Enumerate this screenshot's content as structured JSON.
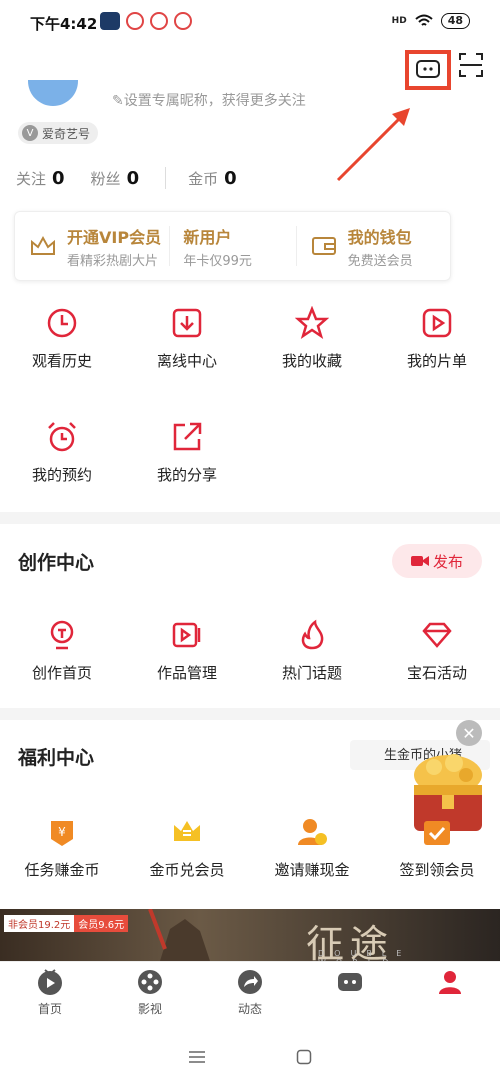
{
  "status_bar": {
    "time": "下午4:42",
    "battery": "48",
    "signal_label": "HD"
  },
  "header": {
    "nickname_hint": "设置专属昵称，获得更多关注",
    "brand_badge": "爱奇艺号",
    "brand_badge_icon": "V"
  },
  "stats": [
    {
      "label": "关注",
      "value": "0"
    },
    {
      "label": "粉丝",
      "value": "0"
    },
    {
      "label": "金币",
      "value": "0"
    }
  ],
  "vip_card": [
    {
      "title": "开通VIP会员",
      "subtitle": "看精彩热剧大片",
      "icon": "crown-icon"
    },
    {
      "title": "新用户",
      "subtitle": "年卡仅99元"
    },
    {
      "title": "我的钱包",
      "subtitle": "免费送会员",
      "icon": "wallet-icon"
    }
  ],
  "my_grid": [
    {
      "label": "观看历史",
      "icon": "clock-icon"
    },
    {
      "label": "离线中心",
      "icon": "download-icon"
    },
    {
      "label": "我的收藏",
      "icon": "star-icon"
    },
    {
      "label": "我的片单",
      "icon": "play-list-icon"
    },
    {
      "label": "我的预约",
      "icon": "alarm-icon"
    },
    {
      "label": "我的分享",
      "icon": "share-icon"
    }
  ],
  "creation": {
    "title": "创作中心",
    "publish_label": "发布",
    "items": [
      {
        "label": "创作首页",
        "icon": "creator-home-icon"
      },
      {
        "label": "作品管理",
        "icon": "video-manage-icon"
      },
      {
        "label": "热门话题",
        "icon": "fire-icon"
      },
      {
        "label": "宝石活动",
        "icon": "gem-icon"
      }
    ]
  },
  "welfare": {
    "title": "福利中心",
    "gold_tip": "生金币的小猪",
    "items": [
      {
        "label": "任务赚金币",
        "icon": "task-coin-icon"
      },
      {
        "label": "金币兑会员",
        "icon": "crown-coin-icon"
      },
      {
        "label": "邀请赚现金",
        "icon": "invite-icon"
      },
      {
        "label": "签到领会员",
        "icon": "checkin-icon"
      }
    ]
  },
  "banner": {
    "price_member": "非会员19.2元",
    "price_vip": "会员9.6元",
    "title": "征途",
    "subtitle": "DOUBLE WORLD"
  },
  "tabbar": [
    {
      "label": "首页",
      "icon": "home-tv-icon"
    },
    {
      "label": "影视",
      "icon": "film-reel-icon"
    },
    {
      "label": "动态",
      "icon": "share-arrow-icon"
    },
    {
      "label": "",
      "icon": "game-icon"
    },
    {
      "label": "",
      "icon": "profile-icon"
    }
  ],
  "colors": {
    "accent": "#e0263a",
    "highlight": "#e8452e",
    "gold": "#b8863b"
  }
}
